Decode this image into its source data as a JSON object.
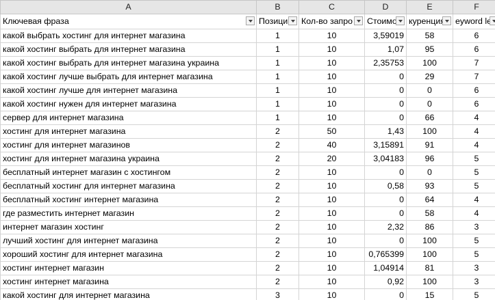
{
  "columns": [
    "A",
    "B",
    "C",
    "D",
    "E",
    "F"
  ],
  "headers": [
    "Ключевая фраза",
    "Позиция",
    "Кол-во запросов",
    "Стоимость",
    "Конкуренция",
    "Keyword length"
  ],
  "headers_visible": [
    "Ключевая фраза",
    "Позици",
    "Кол-во запро",
    "Стоимо",
    "куренция",
    "eyword le"
  ],
  "rows": [
    [
      "какой выбрать хостинг для интернет магазина",
      "1",
      "10",
      "3,59019",
      "58",
      "6"
    ],
    [
      "какой хостинг выбрать для интернет магазина",
      "1",
      "10",
      "1,07",
      "95",
      "6"
    ],
    [
      "какой хостинг выбрать для интернет магазина украина",
      "1",
      "10",
      "2,35753",
      "100",
      "7"
    ],
    [
      "какой хостинг лучше выбрать для интернет магазина",
      "1",
      "10",
      "0",
      "29",
      "7"
    ],
    [
      "какой хостинг лучше для интернет магазина",
      "1",
      "10",
      "0",
      "0",
      "6"
    ],
    [
      "какой хостинг нужен для интернет магазина",
      "1",
      "10",
      "0",
      "0",
      "6"
    ],
    [
      "сервер для интернет магазина",
      "1",
      "10",
      "0",
      "66",
      "4"
    ],
    [
      "хостинг для интернет магазина",
      "2",
      "50",
      "1,43",
      "100",
      "4"
    ],
    [
      "хостинг для интернет магазинов",
      "2",
      "40",
      "3,15891",
      "91",
      "4"
    ],
    [
      "хостинг для интернет магазина украина",
      "2",
      "20",
      "3,04183",
      "96",
      "5"
    ],
    [
      "бесплатный интернет магазин с хостингом",
      "2",
      "10",
      "0",
      "0",
      "5"
    ],
    [
      "бесплатный хостинг для интернет магазина",
      "2",
      "10",
      "0,58",
      "93",
      "5"
    ],
    [
      "бесплатный хостинг интернет магазина",
      "2",
      "10",
      "0",
      "64",
      "4"
    ],
    [
      "где разместить интернет магазин",
      "2",
      "10",
      "0",
      "58",
      "4"
    ],
    [
      "интернет магазин хостинг",
      "2",
      "10",
      "2,32",
      "86",
      "3"
    ],
    [
      "лучший хостинг для интернет магазина",
      "2",
      "10",
      "0",
      "100",
      "5"
    ],
    [
      "хороший хостинг для интернет магазина",
      "2",
      "10",
      "0,765399",
      "100",
      "5"
    ],
    [
      "хостинг интернет магазин",
      "2",
      "10",
      "1,04914",
      "81",
      "3"
    ],
    [
      "хостинг интернет магазина",
      "2",
      "10",
      "0,92",
      "100",
      "3"
    ],
    [
      "какой хостинг для интернет магазина",
      "3",
      "10",
      "0",
      "15",
      "5"
    ]
  ]
}
